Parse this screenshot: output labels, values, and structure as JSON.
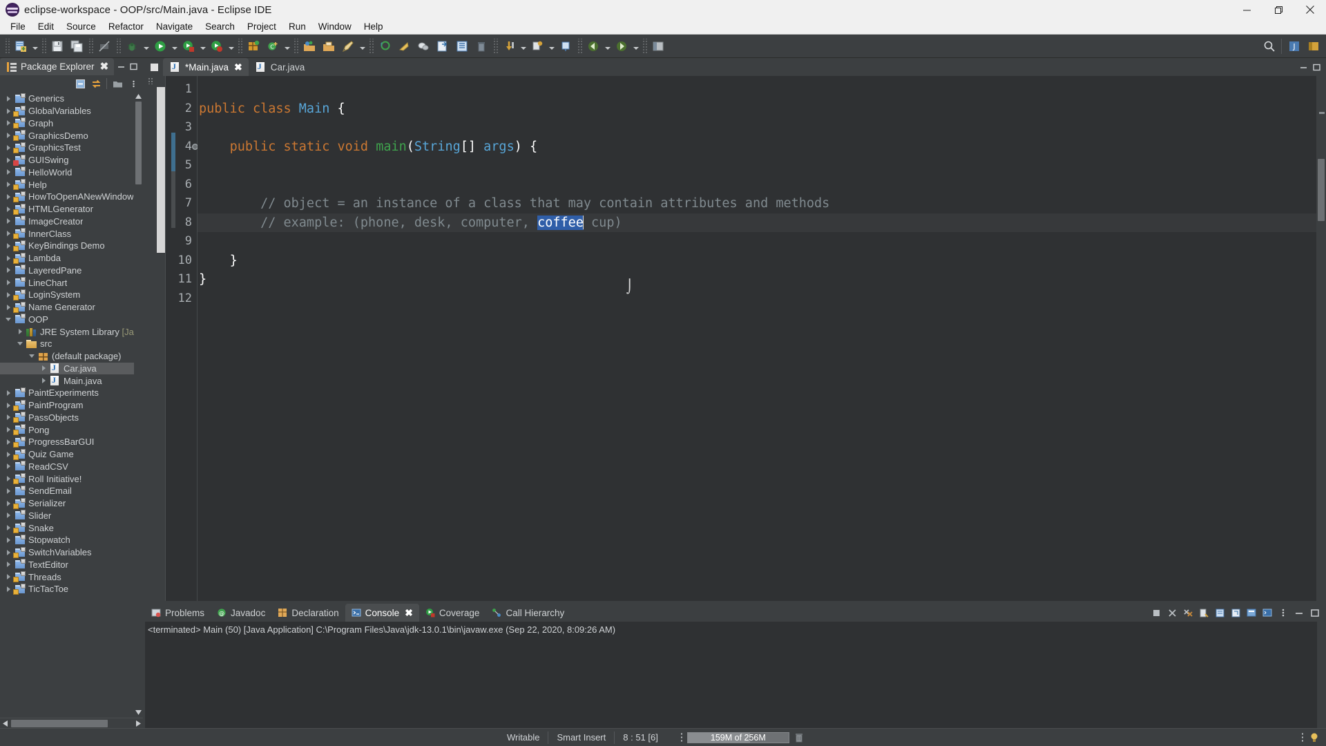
{
  "window": {
    "title": "eclipse-workspace - OOP/src/Main.java - Eclipse IDE",
    "app_icon": "eclipse-icon",
    "minimize_label": "Minimize",
    "restore_label": "Restore",
    "close_label": "Close"
  },
  "menu": {
    "items": [
      {
        "label": "File"
      },
      {
        "label": "Edit"
      },
      {
        "label": "Source"
      },
      {
        "label": "Refactor"
      },
      {
        "label": "Navigate"
      },
      {
        "label": "Search"
      },
      {
        "label": "Project"
      },
      {
        "label": "Run"
      },
      {
        "label": "Window"
      },
      {
        "label": "Help"
      }
    ]
  },
  "toolbar": {
    "buttons": [
      {
        "name": "new-wizard",
        "icon": "new-file-icon"
      },
      {
        "name": "save",
        "icon": "save-icon"
      },
      {
        "name": "save-all",
        "icon": "save-all-icon"
      },
      {
        "name": "print",
        "icon": "print-disabled-icon"
      },
      {
        "name": "debug",
        "icon": "debug-bug-icon"
      },
      {
        "name": "run",
        "icon": "run-green-play-icon"
      },
      {
        "name": "run-coverage",
        "icon": "coverage-icon"
      },
      {
        "name": "run-last",
        "icon": "run-last-icon"
      },
      {
        "name": "new-java-project",
        "icon": "new-java-project-icon"
      },
      {
        "name": "new-class",
        "icon": "new-class-icon"
      },
      {
        "name": "open-type",
        "icon": "open-type-icon"
      },
      {
        "name": "open-task",
        "icon": "open-task-icon"
      },
      {
        "name": "new-annotation",
        "icon": "new-annotation-icon"
      },
      {
        "name": "search",
        "icon": "search-toolbar-icon"
      },
      {
        "name": "skip-breakpoints",
        "icon": "skip-breakpoints-icon"
      },
      {
        "name": "next-annotation",
        "icon": "next-annotation-icon"
      },
      {
        "name": "previous-annotation",
        "icon": "previous-annotation-icon"
      },
      {
        "name": "last-edit-location",
        "icon": "last-edit-location-icon"
      },
      {
        "name": "back",
        "icon": "back-arrow-icon"
      },
      {
        "name": "forward",
        "icon": "forward-arrow-icon"
      },
      {
        "name": "pin-editor",
        "icon": "pin-icon"
      }
    ],
    "search_icon": "search-icon",
    "perspective_java": "java-perspective-icon",
    "perspective_open": "open-perspective-icon"
  },
  "package_explorer": {
    "title": "Package Explorer",
    "tab_icon": "package-explorer-icon",
    "close_icon": "close-icon",
    "minimize_icon": "minimize-icon",
    "maximize_icon": "maximize-icon",
    "tools": [
      {
        "name": "collapse-all",
        "icon": "collapse-all-icon"
      },
      {
        "name": "link-with-editor",
        "icon": "link-editor-icon"
      },
      {
        "name": "view-menu",
        "icon": "view-menu-icon"
      }
    ],
    "tree": [
      {
        "label": "Generics",
        "indent": 0,
        "arrow": "closed",
        "icon": "project-icon",
        "selected": false
      },
      {
        "label": "GlobalVariables",
        "indent": 0,
        "arrow": "closed",
        "icon": "project-locked-icon",
        "selected": false
      },
      {
        "label": "Graph",
        "indent": 0,
        "arrow": "closed",
        "icon": "project-locked-icon",
        "selected": false
      },
      {
        "label": "GraphicsDemo",
        "indent": 0,
        "arrow": "closed",
        "icon": "project-locked-icon",
        "selected": false
      },
      {
        "label": "GraphicsTest",
        "indent": 0,
        "arrow": "closed",
        "icon": "project-locked-icon",
        "selected": false
      },
      {
        "label": "GUISwing",
        "indent": 0,
        "arrow": "closed",
        "icon": "project-error-icon",
        "selected": false
      },
      {
        "label": "HelloWorld",
        "indent": 0,
        "arrow": "closed",
        "icon": "project-icon",
        "selected": false
      },
      {
        "label": "Help",
        "indent": 0,
        "arrow": "closed",
        "icon": "project-locked-icon",
        "selected": false
      },
      {
        "label": "HowToOpenANewWindow",
        "indent": 0,
        "arrow": "closed",
        "icon": "project-locked-icon",
        "selected": false
      },
      {
        "label": "HTMLGenerator",
        "indent": 0,
        "arrow": "closed",
        "icon": "project-locked-icon",
        "selected": false
      },
      {
        "label": "ImageCreator",
        "indent": 0,
        "arrow": "closed",
        "icon": "project-icon",
        "selected": false
      },
      {
        "label": "InnerClass",
        "indent": 0,
        "arrow": "closed",
        "icon": "project-locked-icon",
        "selected": false
      },
      {
        "label": "KeyBindings Demo",
        "indent": 0,
        "arrow": "closed",
        "icon": "project-locked-icon",
        "selected": false
      },
      {
        "label": "Lambda",
        "indent": 0,
        "arrow": "closed",
        "icon": "project-locked-icon",
        "selected": false
      },
      {
        "label": "LayeredPane",
        "indent": 0,
        "arrow": "closed",
        "icon": "project-icon",
        "selected": false
      },
      {
        "label": "LineChart",
        "indent": 0,
        "arrow": "closed",
        "icon": "project-icon",
        "selected": false
      },
      {
        "label": "LoginSystem",
        "indent": 0,
        "arrow": "closed",
        "icon": "project-locked-icon",
        "selected": false
      },
      {
        "label": "Name Generator",
        "indent": 0,
        "arrow": "closed",
        "icon": "project-locked-icon",
        "selected": false
      },
      {
        "label": "OOP",
        "indent": 0,
        "arrow": "open",
        "icon": "project-icon",
        "selected": false
      },
      {
        "label": "JRE System Library ",
        "dim": "[Java",
        "indent": 1,
        "arrow": "closed",
        "icon": "jre-library-icon",
        "selected": false
      },
      {
        "label": "src",
        "indent": 1,
        "arrow": "open",
        "icon": "source-folder-icon",
        "selected": false
      },
      {
        "label": "(default package)",
        "indent": 2,
        "arrow": "open",
        "icon": "package-icon",
        "selected": false
      },
      {
        "label": "Car.java",
        "indent": 3,
        "arrow": "closed",
        "icon": "java-file-icon",
        "selected": true
      },
      {
        "label": "Main.java",
        "indent": 3,
        "arrow": "closed",
        "icon": "java-file-icon",
        "selected": false
      },
      {
        "label": "PaintExperiments",
        "indent": 0,
        "arrow": "closed",
        "icon": "project-icon",
        "selected": false
      },
      {
        "label": "PaintProgram",
        "indent": 0,
        "arrow": "closed",
        "icon": "project-locked-icon",
        "selected": false
      },
      {
        "label": "PassObjects",
        "indent": 0,
        "arrow": "closed",
        "icon": "project-locked-icon",
        "selected": false
      },
      {
        "label": "Pong",
        "indent": 0,
        "arrow": "closed",
        "icon": "project-locked-icon",
        "selected": false
      },
      {
        "label": "ProgressBarGUI",
        "indent": 0,
        "arrow": "closed",
        "icon": "project-locked-icon",
        "selected": false
      },
      {
        "label": "Quiz Game",
        "indent": 0,
        "arrow": "closed",
        "icon": "project-locked-icon",
        "selected": false
      },
      {
        "label": "ReadCSV",
        "indent": 0,
        "arrow": "closed",
        "icon": "project-icon",
        "selected": false
      },
      {
        "label": "Roll Initiative!",
        "indent": 0,
        "arrow": "closed",
        "icon": "project-locked-icon",
        "selected": false
      },
      {
        "label": "SendEmail",
        "indent": 0,
        "arrow": "closed",
        "icon": "project-icon",
        "selected": false
      },
      {
        "label": "Serializer",
        "indent": 0,
        "arrow": "closed",
        "icon": "project-locked-icon",
        "selected": false
      },
      {
        "label": "Slider",
        "indent": 0,
        "arrow": "closed",
        "icon": "project-icon",
        "selected": false
      },
      {
        "label": "Snake",
        "indent": 0,
        "arrow": "closed",
        "icon": "project-locked-icon",
        "selected": false
      },
      {
        "label": "Stopwatch",
        "indent": 0,
        "arrow": "closed",
        "icon": "project-icon",
        "selected": false
      },
      {
        "label": "SwitchVariables",
        "indent": 0,
        "arrow": "closed",
        "icon": "project-locked-icon",
        "selected": false
      },
      {
        "label": "TextEditor",
        "indent": 0,
        "arrow": "closed",
        "icon": "project-icon",
        "selected": false
      },
      {
        "label": "Threads",
        "indent": 0,
        "arrow": "closed",
        "icon": "project-locked-icon",
        "selected": false
      },
      {
        "label": "TicTacToe",
        "indent": 0,
        "arrow": "closed",
        "icon": "project-locked-icon",
        "selected": false
      }
    ]
  },
  "editor": {
    "restore_icon": "restore-view-icon",
    "tabs": [
      {
        "label": "*Main.java",
        "icon": "java-file-icon",
        "active": true,
        "closable": true
      },
      {
        "label": "Car.java",
        "icon": "java-file-icon",
        "active": false,
        "closable": false
      }
    ],
    "minimize_icon": "minimize-icon",
    "maximize_icon": "maximize-icon",
    "line_numbers": [
      "1",
      "2",
      "3",
      "4",
      "5",
      "6",
      "",
      "",
      "",
      "10",
      "11",
      "12"
    ],
    "breakpoint_line": "4",
    "lines": [
      {
        "n": "1",
        "text": "",
        "tokens": []
      },
      {
        "n": "2",
        "text": "public class Main {",
        "tokens": [
          {
            "t": "public ",
            "c": "kw"
          },
          {
            "t": "class ",
            "c": "kw"
          },
          {
            "t": "Main",
            "c": "ty"
          },
          {
            "t": " {",
            "c": "pn"
          }
        ]
      },
      {
        "n": "3",
        "text": "",
        "tokens": []
      },
      {
        "n": "4",
        "text": "    public static void main(String[] args) {",
        "tokens": [
          {
            "t": "    ",
            "c": ""
          },
          {
            "t": "public ",
            "c": "kw"
          },
          {
            "t": "static ",
            "c": "kw"
          },
          {
            "t": "void ",
            "c": "kw"
          },
          {
            "t": "main",
            "c": "mth"
          },
          {
            "t": "(",
            "c": "pn"
          },
          {
            "t": "String",
            "c": "ty"
          },
          {
            "t": "[] ",
            "c": "pn"
          },
          {
            "t": "args",
            "c": "ty"
          },
          {
            "t": ") {",
            "c": "pn"
          }
        ]
      },
      {
        "n": "5",
        "text": "",
        "tokens": []
      },
      {
        "n": "6",
        "text": "",
        "tokens": []
      },
      {
        "n": "7",
        "text": "        // object = an instance of a class that may contain attributes and methods",
        "tokens": [
          {
            "t": "        ",
            "c": ""
          },
          {
            "t": "// object = an instance of a class that may contain attributes and methods",
            "c": "cm"
          }
        ]
      },
      {
        "n": "8",
        "text": "        // example: (phone, desk, computer, coffee cup)",
        "tokens": [
          {
            "t": "        ",
            "c": ""
          },
          {
            "t": "// example: (phone, desk, computer, ",
            "c": "cm"
          },
          {
            "t": "coffee",
            "c": "sel"
          },
          {
            "t": "|",
            "c": "caret"
          },
          {
            "t": " cup)",
            "c": "cm"
          }
        ],
        "highlighted": true
      },
      {
        "n": "9",
        "text": "",
        "tokens": []
      },
      {
        "n": "10",
        "text": "    }",
        "tokens": [
          {
            "t": "    ",
            "c": ""
          },
          {
            "t": "}",
            "c": "pn"
          }
        ]
      },
      {
        "n": "11",
        "text": "}",
        "tokens": [
          {
            "t": "}",
            "c": "pn"
          }
        ]
      },
      {
        "n": "12",
        "text": "",
        "tokens": []
      }
    ],
    "selected_word": "coffee"
  },
  "bottom_panel": {
    "tabs": [
      {
        "label": "Problems",
        "icon": "problems-icon",
        "active": false,
        "closable": false
      },
      {
        "label": "Javadoc",
        "icon": "javadoc-icon",
        "active": false,
        "closable": false
      },
      {
        "label": "Declaration",
        "icon": "declaration-icon",
        "active": false,
        "closable": false
      },
      {
        "label": "Console",
        "icon": "console-icon",
        "active": true,
        "closable": true
      },
      {
        "label": "Coverage",
        "icon": "coverage-tab-icon",
        "active": false,
        "closable": false
      },
      {
        "label": "Call Hierarchy",
        "icon": "call-hierarchy-icon",
        "active": false,
        "closable": false
      }
    ],
    "tools": [
      {
        "name": "terminate",
        "icon": "terminate-icon"
      },
      {
        "name": "remove-launch",
        "icon": "remove-launch-icon"
      },
      {
        "name": "remove-all-terminated",
        "icon": "remove-all-terminated-icon"
      },
      {
        "name": "clear-console",
        "icon": "clear-console-icon"
      },
      {
        "name": "scroll-lock",
        "icon": "scroll-lock-icon"
      },
      {
        "name": "pin-console",
        "icon": "pin-console-icon"
      },
      {
        "name": "display-selected-console",
        "icon": "display-console-icon"
      },
      {
        "name": "open-console",
        "icon": "open-console-icon"
      },
      {
        "name": "view-menu",
        "icon": "view-menu-icon"
      },
      {
        "name": "minimize",
        "icon": "minimize-icon"
      },
      {
        "name": "maximize",
        "icon": "maximize-icon"
      }
    ],
    "console_text": "<terminated> Main (50) [Java Application] C:\\Program Files\\Java\\jdk-13.0.1\\bin\\javaw.exe (Sep 22, 2020, 8:09:26 AM)"
  },
  "status_bar": {
    "writable": "Writable",
    "insert_mode": "Smart Insert",
    "cursor_position": "8 : 51 [6]",
    "memory": "159M of 256M",
    "memory_percent": 62,
    "trash_icon": "trash-icon",
    "bulb_icon": "bulb-icon",
    "grip_icon": "grip-icon"
  },
  "colors": {
    "titlebar_bg": "#f0f0f0",
    "chrome_bg": "#3c3f41",
    "editor_bg": "#2f3133",
    "keyword": "#cc7832",
    "type": "#58a6d8",
    "method": "#3fa34d",
    "comment": "#808a8f",
    "selection": "#2f5ea8",
    "tab_active": "#4a4d4f",
    "tree_selected": "#5a5c5e"
  }
}
